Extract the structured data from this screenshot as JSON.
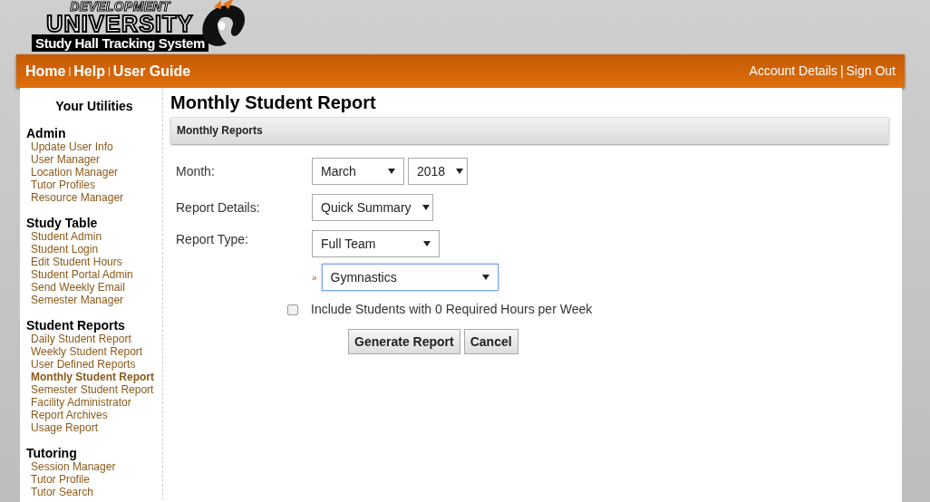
{
  "logo": {
    "line_1": "DEVELOPMENT",
    "line_2": "UNIVERSITY",
    "line_3": "Study Hall Tracking System"
  },
  "nav": {
    "left": [
      {
        "label": "Home",
        "separator": "|"
      },
      {
        "label": "Help",
        "separator": "|"
      },
      {
        "label": "User Guide"
      }
    ],
    "right": [
      {
        "label": "Account Details",
        "separator": "|"
      },
      {
        "label": "Sign Out"
      }
    ]
  },
  "sidebar": {
    "title": "Your Utilities",
    "sections": [
      {
        "heading": "Admin",
        "items": [
          {
            "label": "Update User Info",
            "selected": false
          },
          {
            "label": "User Manager",
            "selected": false
          },
          {
            "label": "Location Manager",
            "selected": false
          },
          {
            "label": "Tutor Profiles",
            "selected": false
          },
          {
            "label": "Resource Manager",
            "selected": false
          }
        ]
      },
      {
        "heading": "Study Table",
        "items": [
          {
            "label": "Student Admin",
            "selected": false
          },
          {
            "label": "Student Login",
            "selected": false
          },
          {
            "label": "Edit Student Hours",
            "selected": false
          },
          {
            "label": "Student Portal Admin",
            "selected": false
          },
          {
            "label": "Send Weekly Email",
            "selected": false
          },
          {
            "label": "Semester Manager",
            "selected": false
          }
        ]
      },
      {
        "heading": "Student Reports",
        "items": [
          {
            "label": "Daily Student Report",
            "selected": false
          },
          {
            "label": "Weekly Student Report",
            "selected": false
          },
          {
            "label": "User Defined Reports",
            "selected": false
          },
          {
            "label": "Monthly Student Report",
            "selected": true
          },
          {
            "label": "Semester Student Report",
            "selected": false
          },
          {
            "label": "Facility Administrator",
            "selected": false
          },
          {
            "label": "Report Archives",
            "selected": false
          },
          {
            "label": "Usage Report",
            "selected": false
          }
        ]
      },
      {
        "heading": "Tutoring",
        "items": [
          {
            "label": "Session Manager",
            "selected": false
          },
          {
            "label": "Tutor Profile",
            "selected": false
          },
          {
            "label": "Tutor Search",
            "selected": false
          }
        ]
      }
    ]
  },
  "page_title": "Monthly Student Report",
  "panel_title": "Monthly Reports",
  "form": {
    "rows": [
      {
        "label": "Month:",
        "selects": [
          {
            "value": "March",
            "focused": false
          },
          {
            "value": "2018",
            "focused": false
          }
        ]
      },
      {
        "label": "Report Details:",
        "selects": [
          {
            "value": "Quick Summary",
            "focused": false
          }
        ]
      },
      {
        "label": "Report Type:",
        "selects": [
          {
            "value": "Full Team",
            "focused": false
          }
        ]
      }
    ],
    "sub_select": {
      "marker": "»",
      "value": "Gymnastics",
      "focused": true
    },
    "checkbox": {
      "label": "Include Students with 0 Required Hours per Week",
      "checked": false
    },
    "buttons": [
      "Generate Report",
      "Cancel"
    ]
  }
}
